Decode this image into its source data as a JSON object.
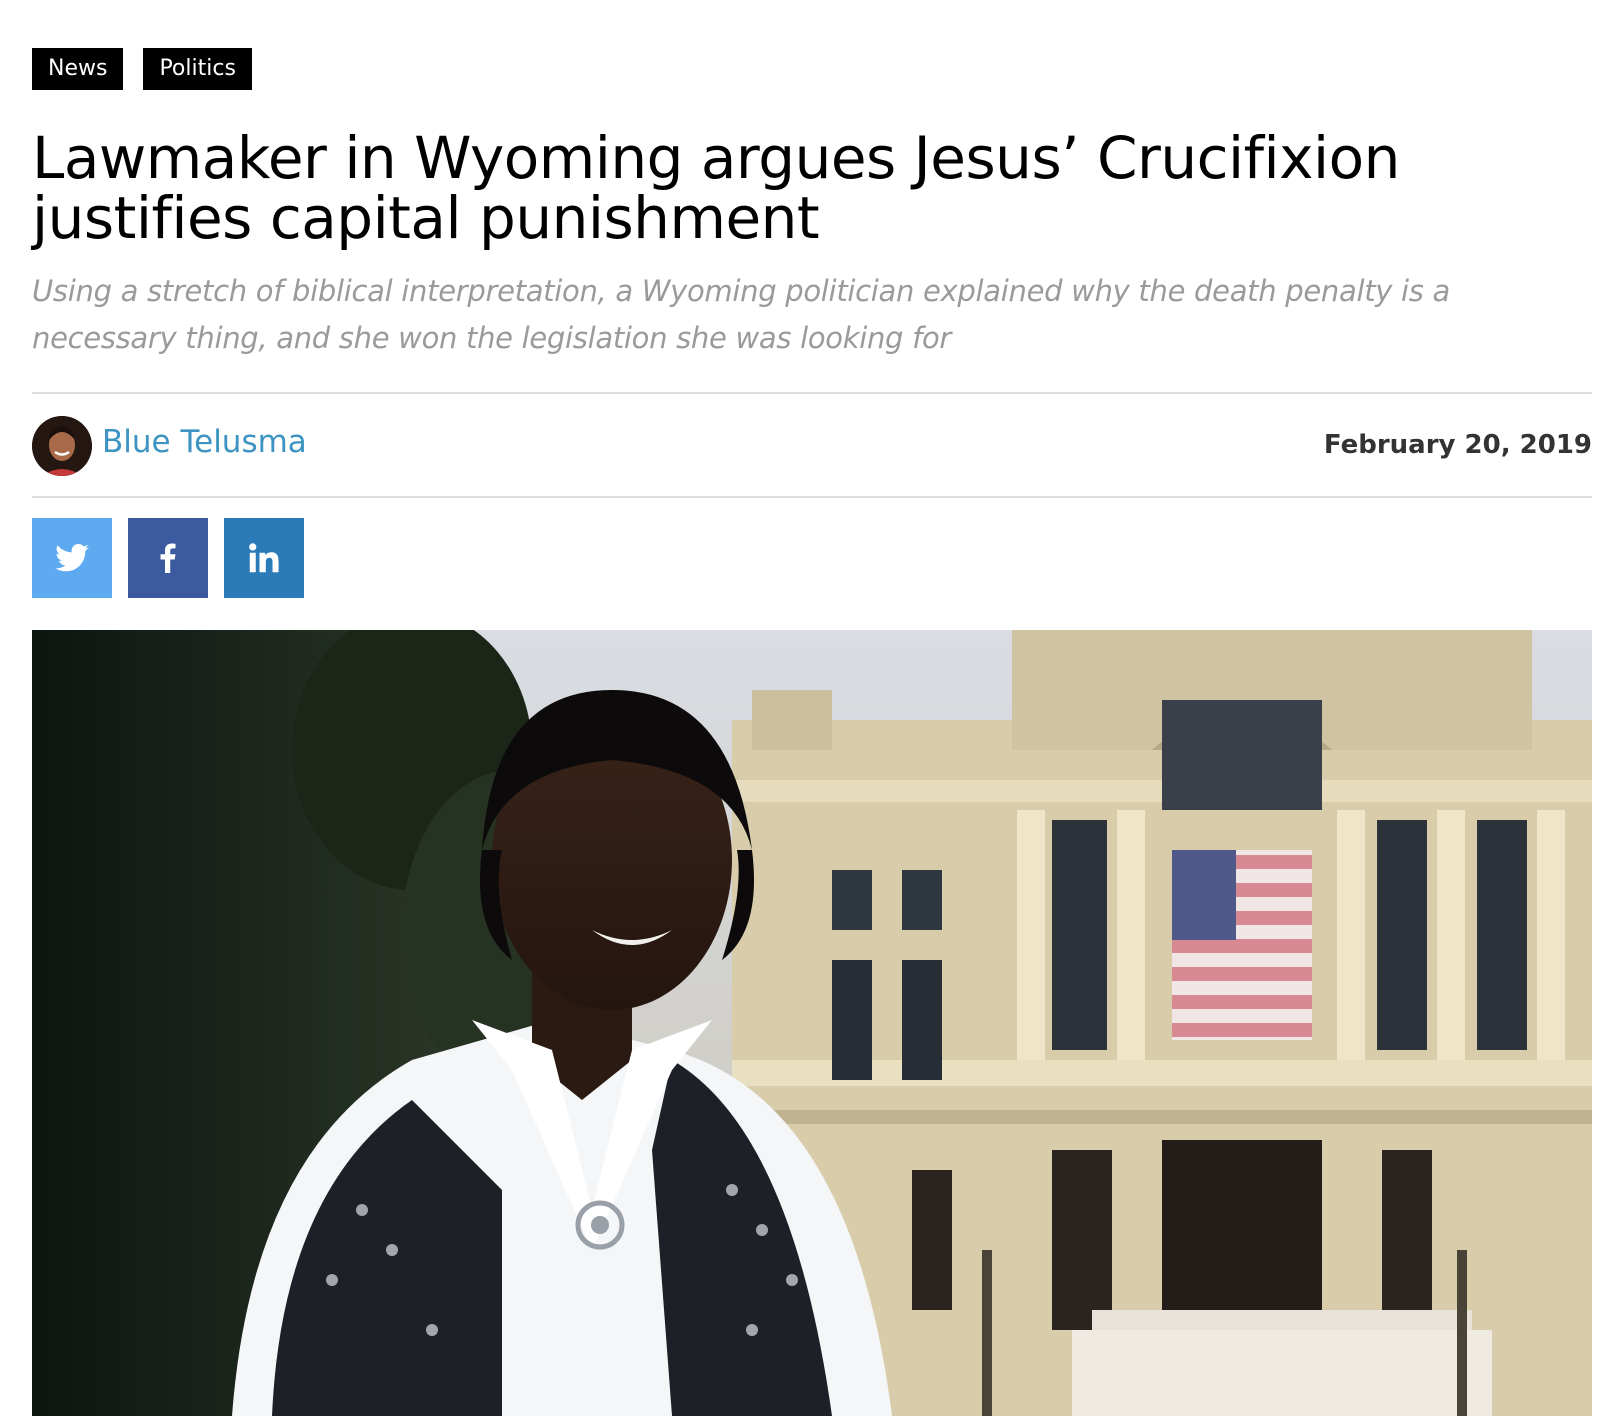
{
  "tags": [
    "News",
    "Politics"
  ],
  "article": {
    "headline": "Lawmaker in Wyoming argues Jesus’ Crucifixion justifies capital punishment",
    "subheadline": "Using a stretch of biblical interpretation, a Wyoming politician explained why the death penalty is a necessary thing, and she won the legislation she was looking for",
    "author": "Blue Telusma",
    "date": "February 20, 2019"
  },
  "share": {
    "buttons": [
      {
        "icon": "twitter-icon",
        "color": "#5eaaf0"
      },
      {
        "icon": "facebook-icon",
        "color": "#3b5aa0"
      },
      {
        "icon": "linkedin-icon",
        "color": "#2b7bb9"
      }
    ]
  },
  "colors": {
    "tag_bg": "#000000",
    "author_link": "#3d94c2",
    "subhead": "#9a9a9a",
    "divider": "#dedede"
  }
}
